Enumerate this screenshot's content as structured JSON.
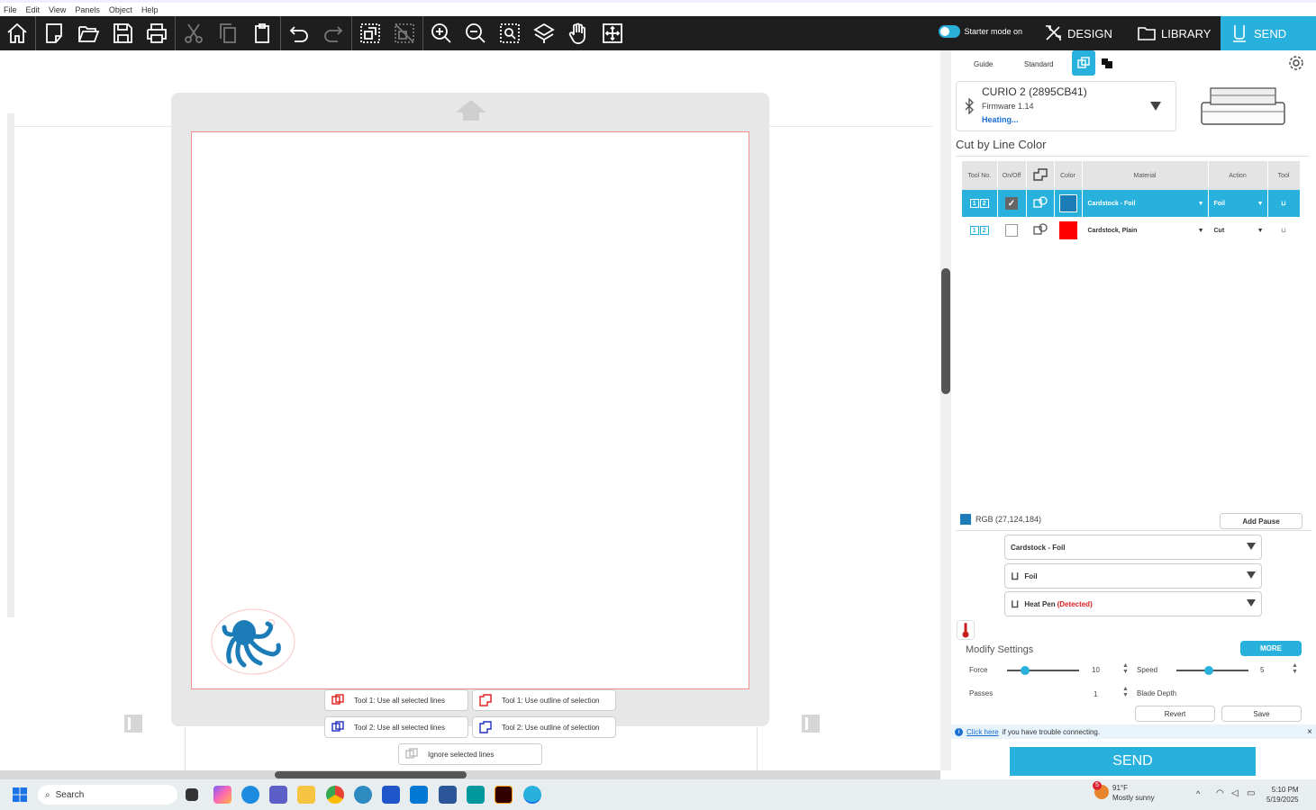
{
  "menu": [
    "File",
    "Edit",
    "View",
    "Panels",
    "Object",
    "Help"
  ],
  "toolbar": {
    "mode_label": "Starter mode on",
    "tabs": {
      "design": "DESIGN",
      "library": "LIBRARY",
      "send": "SEND"
    }
  },
  "canvas": {
    "context_buttons": {
      "t1_all": "Tool 1: Use all selected lines",
      "t1_outline": "Tool 1: Use outline of selection",
      "t2_all": "Tool 2: Use all selected lines",
      "t2_outline": "Tool 2: Use outline of selection",
      "ignore": "Ignore selected lines"
    }
  },
  "panel": {
    "tabs": {
      "guide": "Guide",
      "standard": "Standard"
    },
    "device": {
      "name": "CURIO 2 (2895CB41)",
      "firmware": "Firmware 1.14",
      "status": "Heating..."
    },
    "section_title": "Cut by Line Color",
    "table": {
      "headers": [
        "Tool No.",
        "On/Off",
        "",
        "Color",
        "Material",
        "Action",
        "Tool"
      ],
      "rows": [
        {
          "tool": [
            "1",
            "2"
          ],
          "on": true,
          "color": "#1b7cb8",
          "material": "Cardstock - Foil",
          "action": "Foil"
        },
        {
          "tool": [
            "1",
            "2"
          ],
          "on": false,
          "color": "#ff0000",
          "material": "Cardstock, Plain",
          "action": "Cut"
        }
      ]
    },
    "rgb_label": "RGB (27,124,184)",
    "add_pause": "Add Pause",
    "material_select": "Cardstock - Foil",
    "action_select": "Foil",
    "tool_select": "Heat Pen",
    "tool_detected": "(Detected)",
    "modify_title": "Modify Settings",
    "more": "MORE",
    "force_label": "Force",
    "force_value": "10",
    "speed_label": "Speed",
    "speed_value": "5",
    "passes_label": "Passes",
    "passes_value": "1",
    "blade_label": "Blade Depth",
    "revert": "Revert",
    "save": "Save",
    "info_link": "Click here",
    "info_text": "if you have trouble connecting.",
    "send": "SEND"
  },
  "taskbar": {
    "search": "Search",
    "weather_temp": "91°F",
    "weather_desc": "Mostly sunny",
    "weather_badge": "5",
    "time": "5:10 PM",
    "date": "5/19/2025"
  },
  "colors": {
    "accent": "#29b1de",
    "toolbar": "#1e1e1e",
    "foil_blue": "#1b7cb8",
    "cut_red": "#ff0000"
  }
}
